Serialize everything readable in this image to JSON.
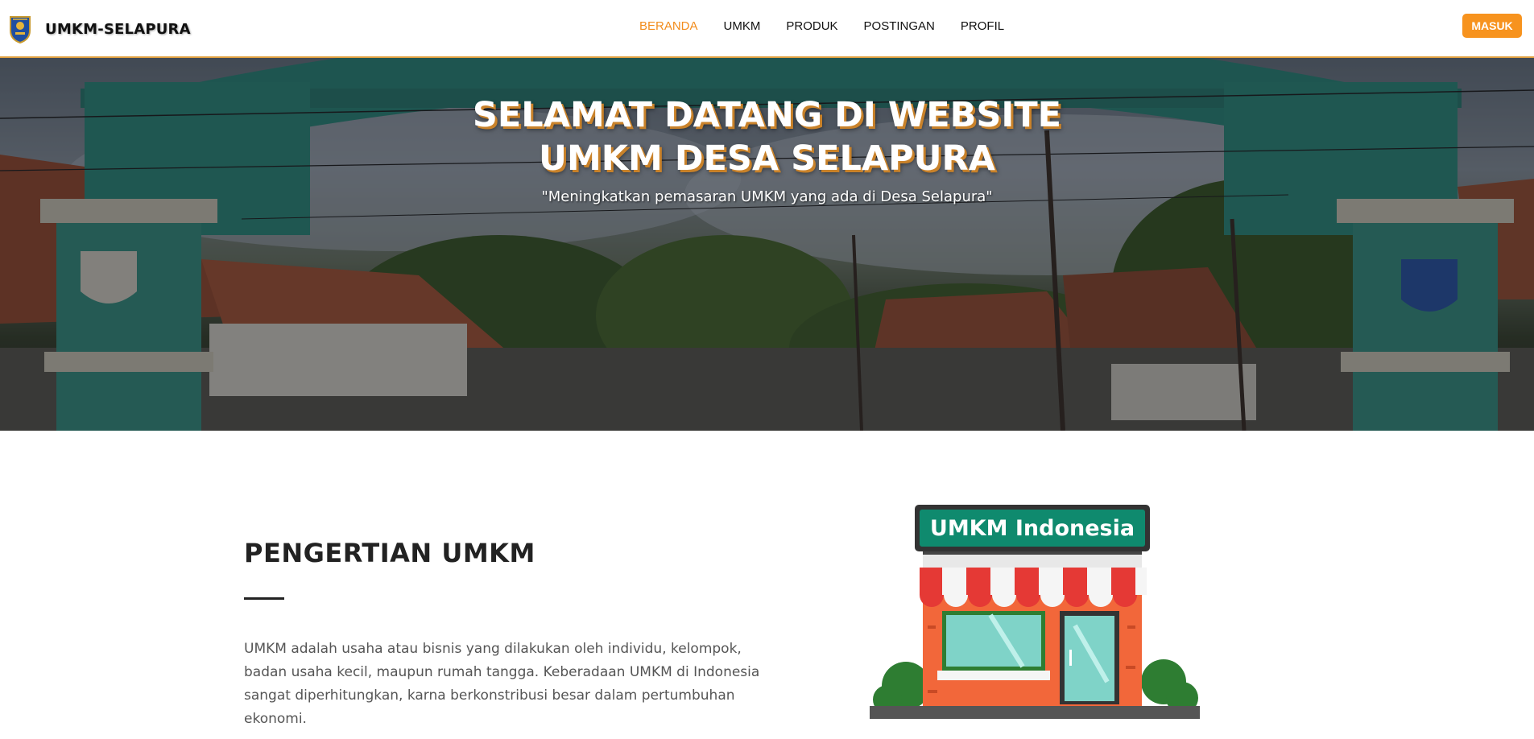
{
  "brand": {
    "name": "UMKM-SELAPURA",
    "logo_icon": "emblem-shield-icon"
  },
  "nav": {
    "items": [
      {
        "label": "BERANDA",
        "active": true
      },
      {
        "label": "UMKM",
        "active": false
      },
      {
        "label": "PRODUK",
        "active": false
      },
      {
        "label": "POSTINGAN",
        "active": false
      },
      {
        "label": "PROFIL",
        "active": false
      }
    ],
    "login_label": "MASUK"
  },
  "hero": {
    "title_line1": "SELAMAT DATANG DI WEBSITE",
    "title_line2": "UMKM DESA SELAPURA",
    "subtitle": "\"Meningkatkan pemasaran UMKM yang ada di Desa Selapura\"",
    "background_image": "village-gate-photo"
  },
  "about": {
    "title": "PENGERTIAN UMKM",
    "body": "UMKM adalah usaha atau bisnis yang dilakukan oleh individu, kelompok, badan usaha kecil, maupun rumah tangga. Keberadaan UMKM di Indonesia sangat diperhitungkan, karna berkonstribusi besar dalam pertumbuhan ekonomi.",
    "illustration_sign": "UMKM Indonesia",
    "illustration_icon": "storefront-illustration"
  },
  "colors": {
    "accent": "#f7931e",
    "active_nav": "#f28c1c",
    "sign_green": "#0f8a6e"
  }
}
